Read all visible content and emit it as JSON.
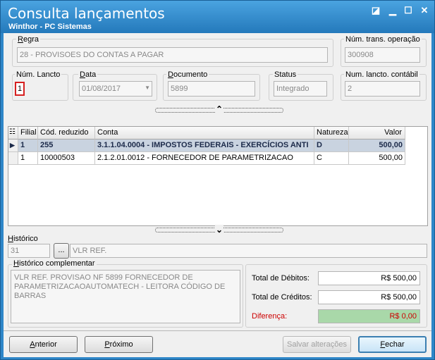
{
  "window": {
    "title": "Consulta lançamentos",
    "subtitle": "Winthor - PC Sistemas",
    "controls": {
      "help": "◪",
      "minimize": "▁",
      "maximize": "☐",
      "close": "✕"
    }
  },
  "header": {
    "regra": {
      "label_u": "R",
      "label_rest": "egra",
      "value": "28 - PROVISOES DO CONTAS A PAGAR"
    },
    "num_trans": {
      "label": "Núm. trans. operação",
      "value": "300908"
    },
    "num_lancto": {
      "label": "Núm. Lancto",
      "value": "1"
    },
    "data": {
      "label_u": "D",
      "label_rest": "ata",
      "value": "01/08/2017"
    },
    "documento": {
      "label_u": "D",
      "label_rest": "ocumento",
      "value": "5899"
    },
    "status": {
      "label": "Status",
      "value": "Integrado"
    },
    "num_contabil": {
      "label": "Num. lancto. contábil",
      "value": "2"
    }
  },
  "splitter_top_icon": "⌃",
  "splitter_bottom_icon": "⌄",
  "grid": {
    "columns": [
      "Filial",
      "Cód. reduzido",
      "Conta",
      "Natureza",
      "Valor"
    ],
    "rows": [
      {
        "filial": "1",
        "cod": "255",
        "conta": "3.1.1.04.0004 - IMPOSTOS FEDERAIS - EXERCÍCIOS ANTI",
        "natureza": "D",
        "valor": "500,00"
      },
      {
        "filial": "1",
        "cod": "10000503",
        "conta": "2.1.2.01.0012 - FORNECEDOR DE PARAMETRIZACAO",
        "natureza": "C",
        "valor": "500,00"
      }
    ]
  },
  "historico": {
    "label_u": "H",
    "label_rest": "istórico",
    "code": "31",
    "browse": "...",
    "text": "VLR REF."
  },
  "historico_complementar": {
    "label_u": "H",
    "label_rest": "istórico complementar",
    "text": "VLR REF. PROVISAO NF 5899  FORNECEDOR DE PARAMETRIZACAOAUTOMATECH - LEITORA CÓDIGO DE BARRAS"
  },
  "totals": {
    "debitos": {
      "label": "Total de Débitos:",
      "value": "R$ 500,00"
    },
    "creditos": {
      "label": "Total de Créditos:",
      "value": "R$ 500,00"
    },
    "diferenca": {
      "label": "Diferença:",
      "value": "R$ 0,00"
    }
  },
  "buttons": {
    "anterior_u": "A",
    "anterior_rest": "nterior",
    "proximo_u": "P",
    "proximo_rest": "róximo",
    "salvar": "Salvar alterações",
    "fechar_u": "F",
    "fechar_rest": "echar"
  },
  "colors": {
    "title_bar": "#2e86c8",
    "diferenca_label": "#cc0000",
    "diferenca_bg": "#a9d8a9",
    "selected_row": "#c9d3e0"
  }
}
